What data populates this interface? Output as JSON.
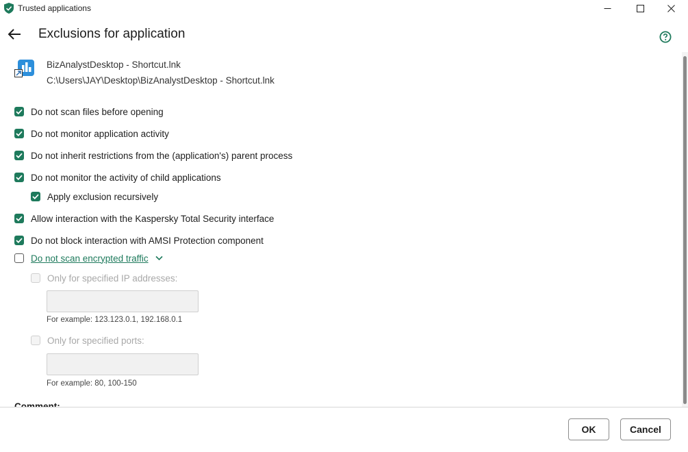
{
  "window": {
    "title": "Trusted applications"
  },
  "header": {
    "title": "Exclusions for application"
  },
  "application": {
    "name": "BizAnalystDesktop - Shortcut.lnk",
    "path": "C:\\Users\\JAY\\Desktop\\BizAnalystDesktop - Shortcut.lnk"
  },
  "options": [
    {
      "label": "Do not scan files before opening",
      "checked": true
    },
    {
      "label": "Do not monitor application activity",
      "checked": true
    },
    {
      "label": "Do not inherit restrictions from the (application's) parent process",
      "checked": true
    },
    {
      "label": "Do not monitor the activity of child applications",
      "checked": true
    },
    {
      "label": "Apply exclusion recursively",
      "checked": true
    },
    {
      "label": "Allow interaction with the Kaspersky Total Security interface",
      "checked": true
    },
    {
      "label": "Do not block interaction with AMSI Protection component",
      "checked": true
    },
    {
      "label": "Do not scan encrypted traffic",
      "checked": false
    }
  ],
  "encrypted_traffic": {
    "ip_label": "Only for specified IP addresses:",
    "ip_value": "",
    "ip_hint": "For example: 123.123.0.1, 192.168.0.1",
    "ports_label": "Only for specified ports:",
    "ports_value": "",
    "ports_hint": "For example: 80, 100-150"
  },
  "comment": {
    "label": "Comment:"
  },
  "footer": {
    "ok_label": "OK",
    "cancel_label": "Cancel"
  },
  "colors": {
    "accent": "#1e7a5c",
    "disabled_text": "#a8a8a8",
    "input_bg": "#f1f1f1"
  },
  "icons": {
    "app": "kaspersky-shield-icon",
    "minimize": "minimize-icon",
    "maximize": "maximize-icon",
    "close": "close-icon",
    "back": "back-arrow-icon",
    "help": "help-icon",
    "file": "application-file-icon",
    "expand": "chevron-down-icon"
  }
}
